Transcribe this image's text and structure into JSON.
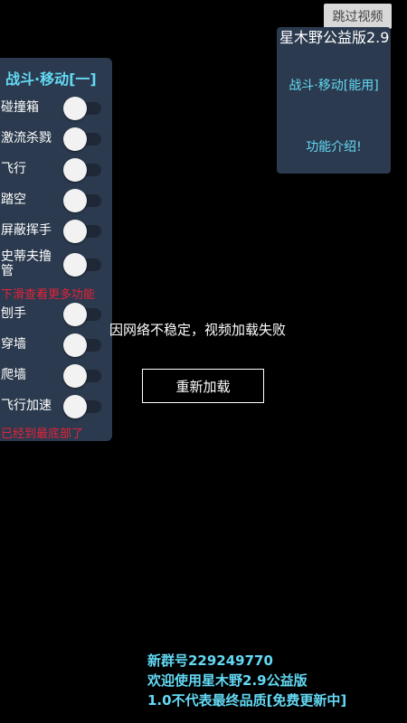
{
  "skip_button": "跳过视频",
  "left_panel": {
    "title": "战斗·移动[一]",
    "items_a": [
      "碰撞箱",
      "激流杀戮",
      "飞行",
      "踏空",
      "屏蔽挥手",
      "史蒂夫撸管"
    ],
    "hint_more": "下滑查看更多功能",
    "items_b": [
      "刨手",
      "穿墙",
      "爬墙",
      "飞行加速"
    ],
    "hint_bottom": "已经到最底部了"
  },
  "right_panel": {
    "title": "星木野公益版2.9",
    "link_1": "战斗·移动[能用]",
    "link_2": "功能介绍!"
  },
  "video_error": {
    "message": "因网络不稳定，视频加载失败",
    "reload": "重新加载"
  },
  "footer": {
    "line_1": "新群号229249770",
    "line_2": "欢迎使用星木野2.9公益版",
    "line_3": "1.0不代表最终品质[免费更新中]"
  },
  "colors": {
    "background": "#000000",
    "panel": "#2b3a4e",
    "accent": "#63d9f4",
    "warning": "#e5233a"
  }
}
